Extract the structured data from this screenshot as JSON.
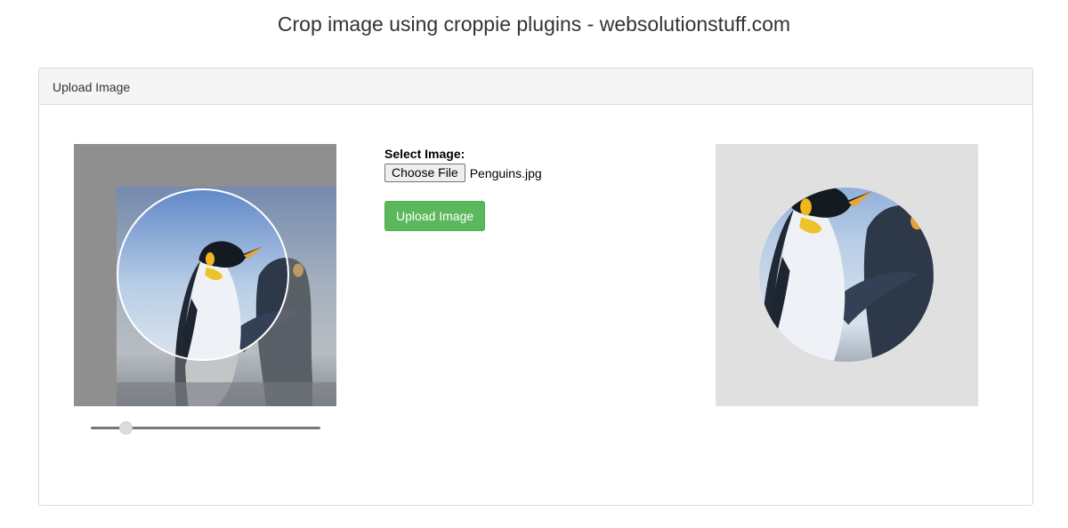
{
  "page": {
    "title": "Crop image using croppie plugins - websolutionstuff.com"
  },
  "panel": {
    "heading": "Upload Image"
  },
  "cropper": {
    "zoom_level": 0.13
  },
  "form": {
    "label": "Select Image:",
    "choose_file_label": "Choose File",
    "file_name": "Penguins.jpg",
    "upload_button_label": "Upload Image"
  },
  "colors": {
    "success_button": "#5cb85c",
    "panel_heading_bg": "#f5f5f5",
    "preview_bg": "#e0e0e0",
    "cropper_overlay": "#8f8f8f"
  }
}
